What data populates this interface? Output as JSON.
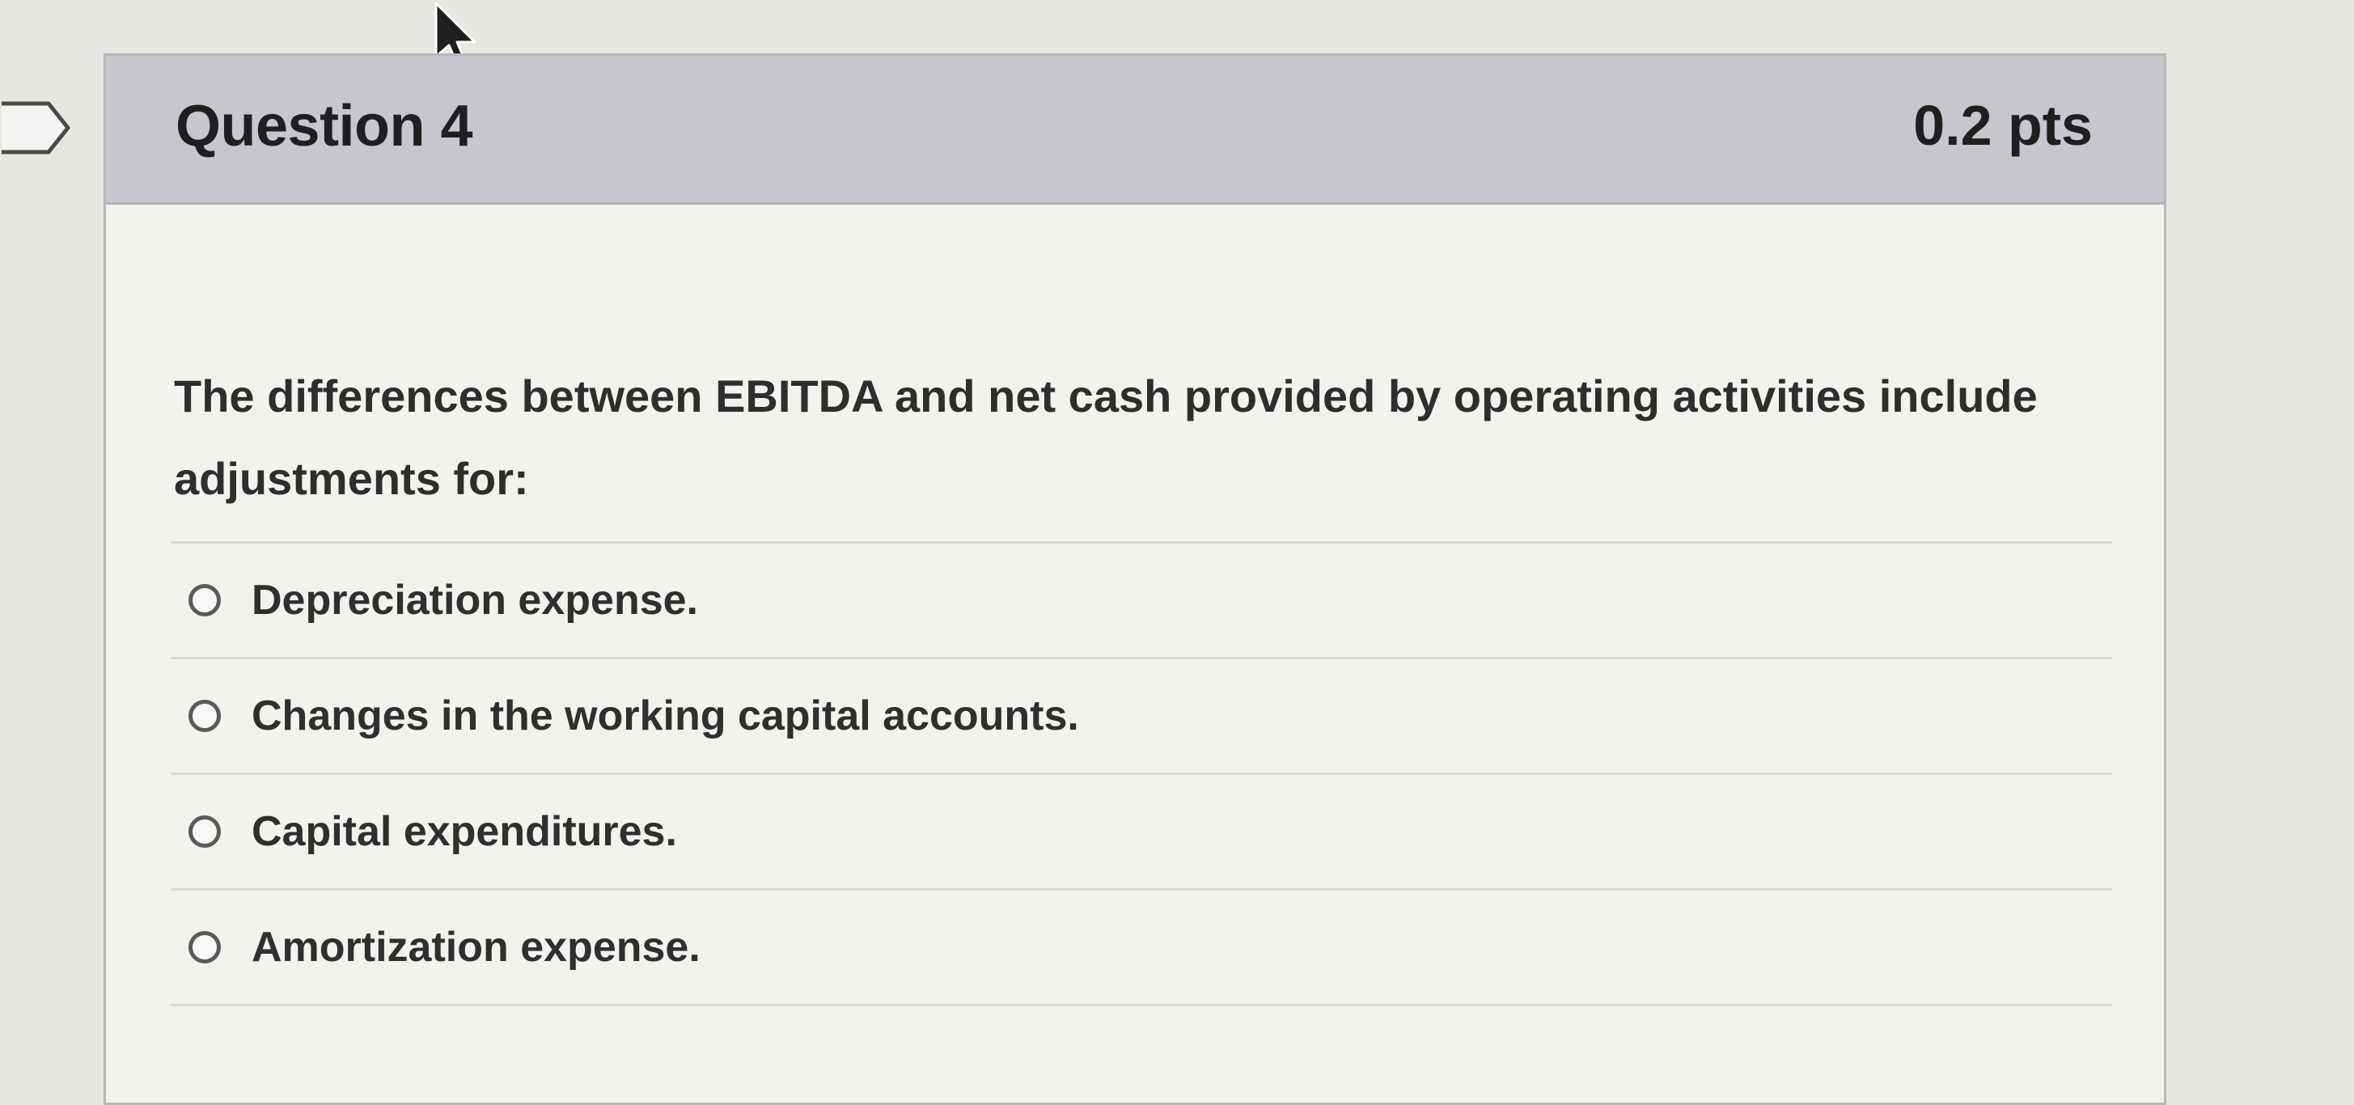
{
  "question": {
    "title": "Question 4",
    "points": "0.2 pts",
    "text": "The differences between EBITDA and net cash provided by operating activities include adjustments for:"
  },
  "answers": [
    {
      "label": "Depreciation expense.",
      "selected": false
    },
    {
      "label": "Changes in the working capital accounts.",
      "selected": false
    },
    {
      "label": "Capital expenditures.",
      "selected": false
    },
    {
      "label": "Amortization expense.",
      "selected": false
    }
  ],
  "icons": {
    "flag": "flag-question-icon",
    "cursor": "mouse-cursor-icon",
    "radio": "radio-button-icon"
  },
  "colors": {
    "header_background": "#c5c7cd",
    "card_background": "#f2f2ef",
    "page_background": "#e6e6e3"
  }
}
